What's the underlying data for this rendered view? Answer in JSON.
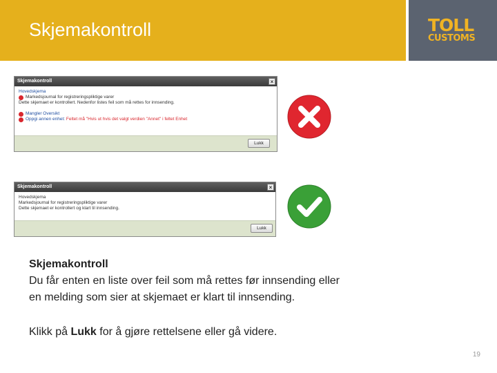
{
  "header": {
    "title": "Skjemakontroll",
    "logo_top": "TOLL",
    "logo_bottom": "CUSTOMS"
  },
  "screenshot_error": {
    "window_title": "Skjemakontroll",
    "close_glyph": "×",
    "section_label": "Hovedskjema",
    "lines": [
      "Markedsjournal for registreringspliktige varer",
      "Dette skjemaet er kontrollert. Nedenfor listes feil som må rettes for innsending."
    ],
    "error_section": "Mangler Oversikt",
    "error_field": "Oppgi annen enhet:",
    "error_detail": "Feltet må \"Hvis ut hvis det valgt verdien \"Annet\" i feltet Enhet",
    "button_label": "Lukk",
    "status_icon": "error-x-icon",
    "status_color": "#e0262f"
  },
  "screenshot_success": {
    "window_title": "Skjemakontroll",
    "close_glyph": "×",
    "section_label": "Hovedskjema",
    "lines": [
      "Markedsjournal for registreringspliktige varer",
      "Dette skjemaet er kontrollert og klart til innsending."
    ],
    "button_label": "Lukk",
    "status_icon": "success-check-icon",
    "status_color": "#3aa037"
  },
  "description": {
    "title": "Skjemakontroll",
    "line1": "Du får enten en liste over feil som må rettes før innsending eller",
    "line2": "en melding som sier at skjemaet er klart til innsending."
  },
  "instruction": {
    "prefix": "Klikk på ",
    "bold": "Lukk",
    "suffix": " for å gjøre rettelsene eller gå videre."
  },
  "page_number": "19",
  "colors": {
    "header_bg": "#e5b01c",
    "logo_bg": "#5b6370",
    "logo_text": "#f0b323"
  }
}
